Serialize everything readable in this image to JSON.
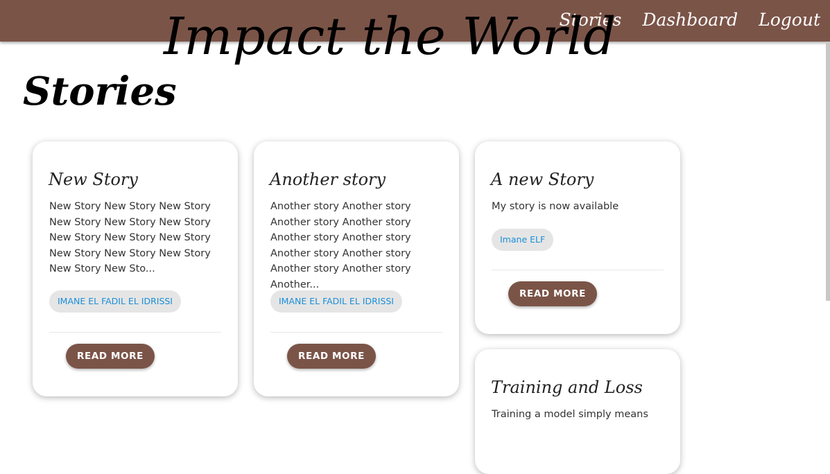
{
  "header": {
    "brand": "Impact the World",
    "nav": [
      "Stories",
      "Dashboard",
      "Logout"
    ],
    "bar_color": "#7b5448"
  },
  "page": {
    "title": "Stories"
  },
  "stories": [
    {
      "title": "New Story",
      "excerpt": "New Story New Story New Story New Story New Story New Story New Story New Story New Story New Story New Story New Story New Story New Sto...",
      "author": "IMANE EL FADIL EL IDRISSI",
      "button": "READ MORE"
    },
    {
      "title": "Another story",
      "excerpt": "Another story Another story Another story Another story Another story Another story Another story Another story Another story Another story Another...",
      "author": "IMANE EL FADIL EL IDRISSI",
      "button": "READ MORE"
    },
    {
      "title": "A new Story",
      "excerpt": "My story is now available",
      "author": "Imane ELF",
      "button": "READ MORE"
    },
    {
      "title": "Training and Loss",
      "excerpt": "Training a model simply means"
    }
  ]
}
